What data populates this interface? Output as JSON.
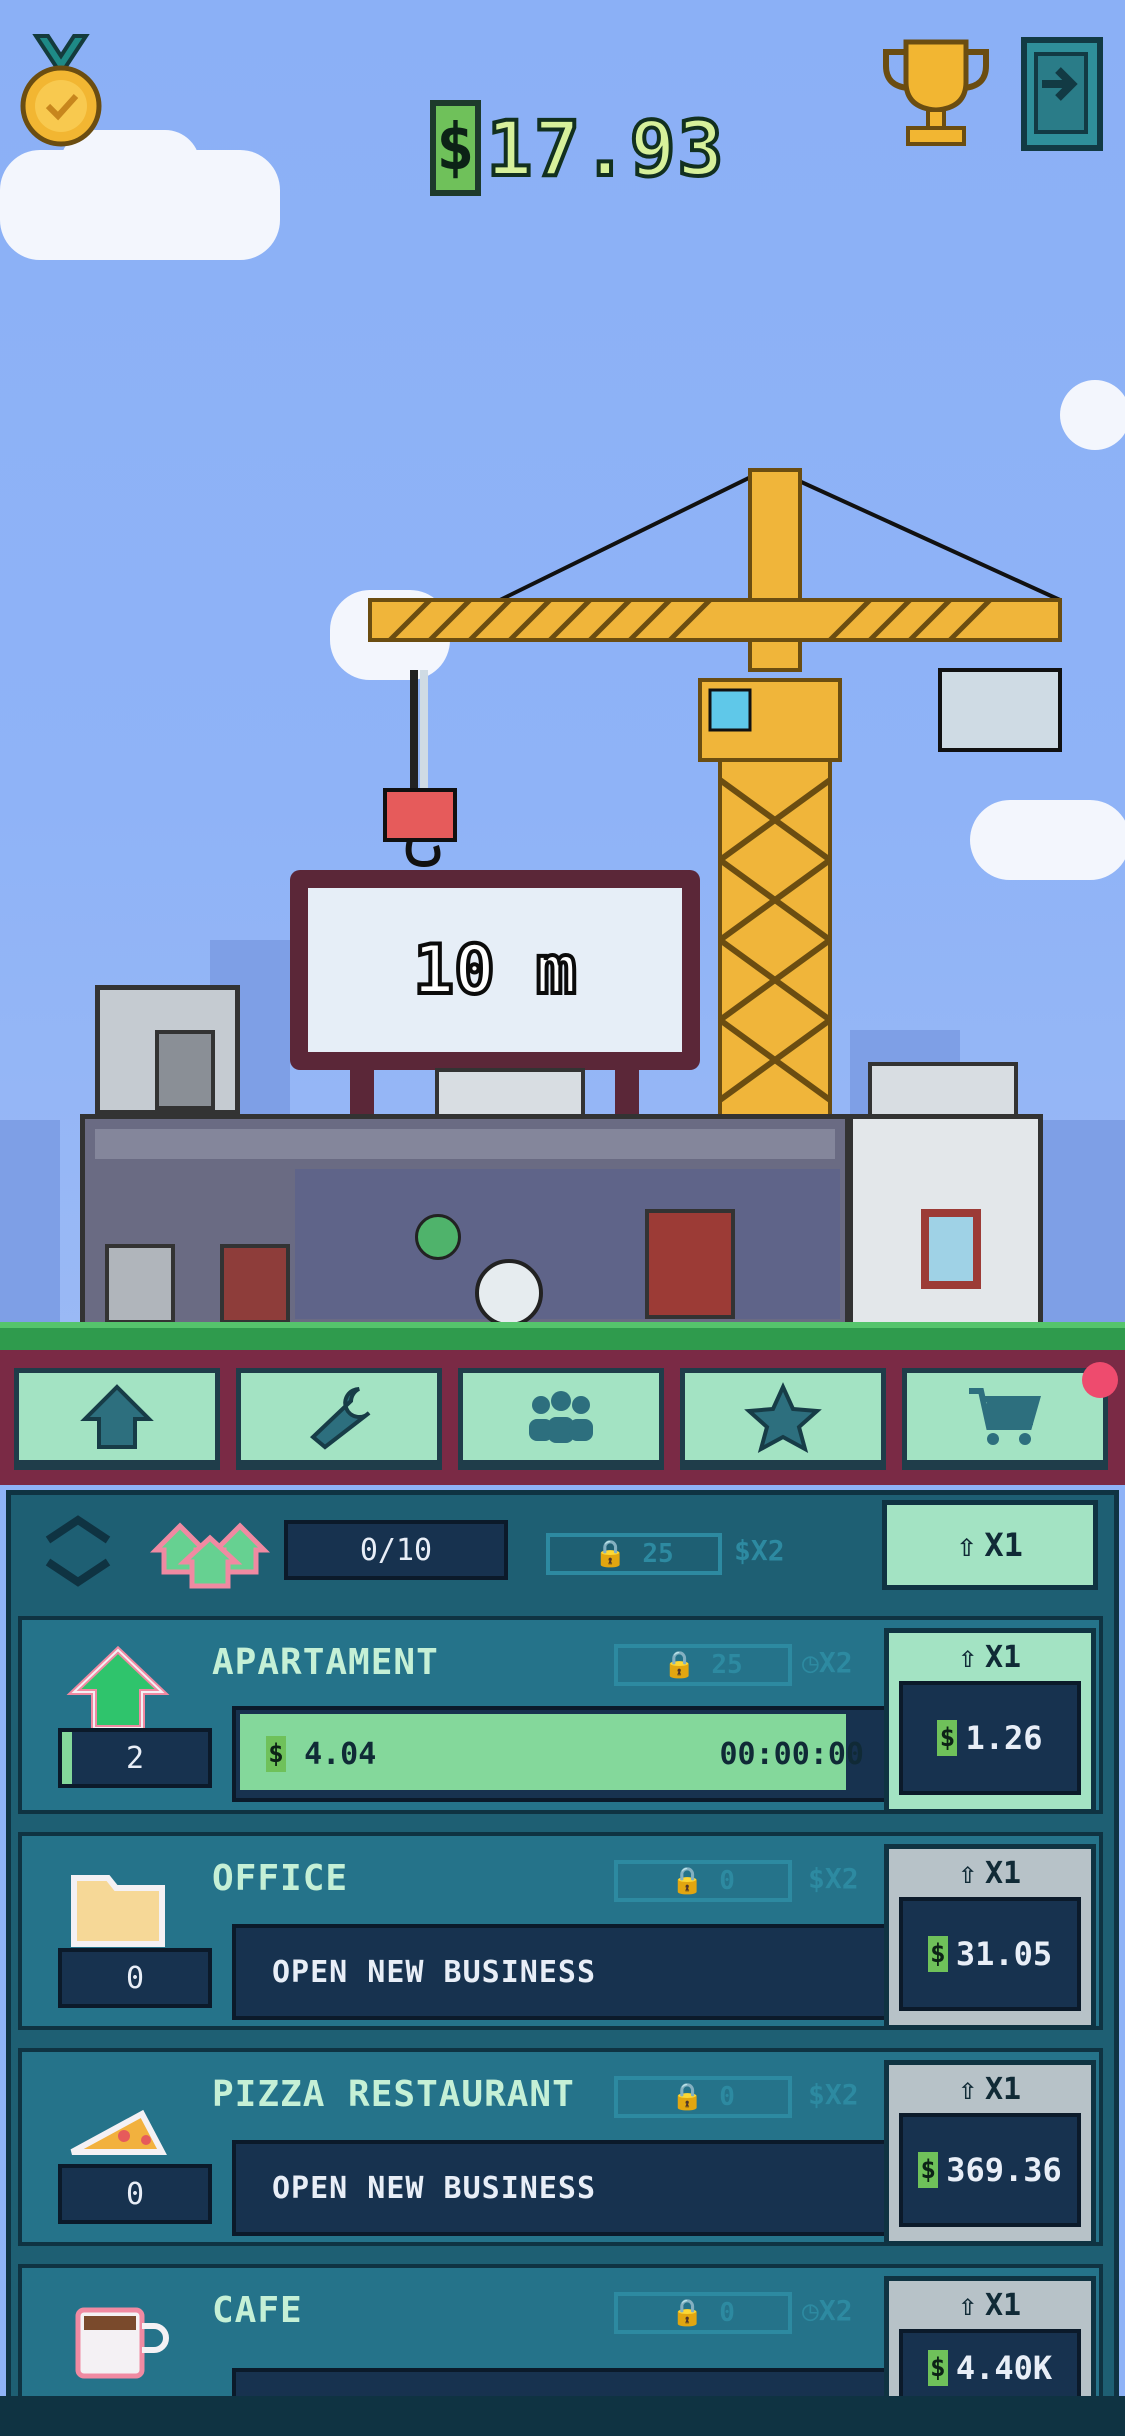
{
  "header": {
    "balance": "17.93",
    "currency_symbol": "$",
    "medal_icon": "medal-icon",
    "trophy_icon": "trophy-icon",
    "exit_icon": "exit-icon"
  },
  "scene": {
    "billboard_text": "10 m"
  },
  "tabs": [
    {
      "icon": "home-icon"
    },
    {
      "icon": "wrench-icon"
    },
    {
      "icon": "people-icon"
    },
    {
      "icon": "star-icon"
    },
    {
      "icon": "cart-icon"
    }
  ],
  "panel": {
    "houses_counter": "0/10",
    "lock_value": "25",
    "bonus": "$X2",
    "multiplier": "X1"
  },
  "businesses": [
    {
      "name": "APARTAMENT",
      "count": "2",
      "lock": "25",
      "bonus": "X2",
      "bonus_type": "clock",
      "income": "4.04",
      "timer": "00:00:00",
      "progress": 0.93,
      "buy_multiplier": "X1",
      "price": "1.26",
      "active": true
    },
    {
      "name": "OFFICE",
      "count": "0",
      "lock": "0",
      "bonus": "$X2",
      "bonus_type": "money",
      "action": "OPEN NEW BUSINESS",
      "buy_multiplier": "X1",
      "price": "31.05",
      "active": false
    },
    {
      "name": "PIZZA RESTAURANT",
      "count": "0",
      "lock": "0",
      "bonus": "$X2",
      "bonus_type": "money",
      "action": "OPEN NEW BUSINESS",
      "buy_multiplier": "X1",
      "price": "369.36",
      "active": false
    },
    {
      "name": "CAFE",
      "count": "",
      "lock": "0",
      "bonus": "X2",
      "bonus_type": "clock",
      "action": "",
      "buy_multiplier": "X1",
      "price": "4.40K",
      "active": false
    }
  ],
  "colors": {
    "sky": "#8fb3f7",
    "panel": "#1e5f73",
    "tab": "#a3e3c3",
    "tab_bar": "#7a2a45",
    "progress": "#84d89b",
    "crane": "#f0b53a"
  }
}
